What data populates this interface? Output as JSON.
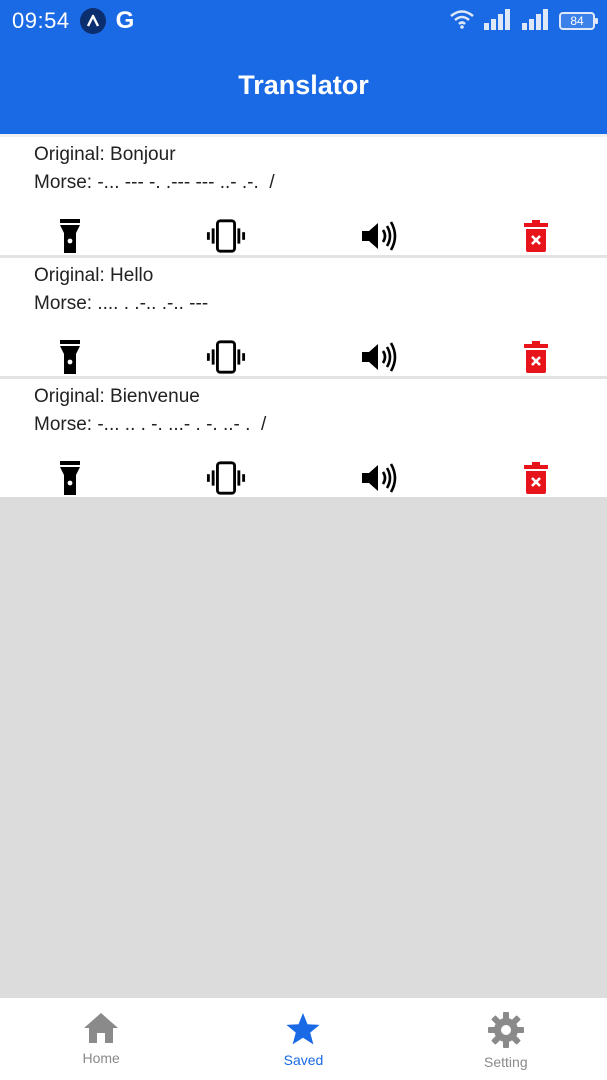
{
  "status": {
    "time": "09:54",
    "app_letter": "G",
    "battery": "84"
  },
  "header": {
    "title": "Translator"
  },
  "items": [
    {
      "original": "Original: Bonjour",
      "morse": "Morse: -... --- -. .--- --- ..- .-.  /"
    },
    {
      "original": "Original: Hello",
      "morse": "Morse: .... . .-.. .-.. ---"
    },
    {
      "original": "Original: Bienvenue",
      "morse": "Morse: -... .. . -. ...- . -. ..- .  /"
    }
  ],
  "actions": [
    "flashlight-icon",
    "vibrate-icon",
    "speaker-icon",
    "delete-icon"
  ],
  "nav": [
    {
      "label": "Home",
      "icon": "home-icon"
    },
    {
      "label": "Saved",
      "icon": "star-icon"
    },
    {
      "label": "Setting",
      "icon": "gear-icon"
    }
  ],
  "colors": {
    "primary": "#1a6ae6",
    "delete": "#e8141c",
    "background": "#dcdcdc"
  }
}
